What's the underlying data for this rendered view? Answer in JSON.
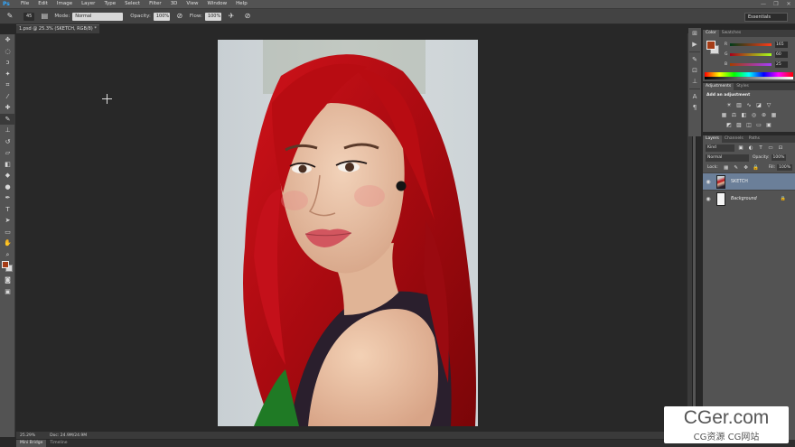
{
  "app": {
    "logo": "Ps"
  },
  "menu": [
    "File",
    "Edit",
    "Image",
    "Layer",
    "Type",
    "Select",
    "Filter",
    "3D",
    "View",
    "Window",
    "Help"
  ],
  "window_controls": {
    "minimize": "—",
    "restore": "❐",
    "close": "✕"
  },
  "options_bar": {
    "brush_size": "45",
    "mode_label": "Mode:",
    "mode_value": "Normal",
    "opacity_label": "Opacity:",
    "opacity_value": "100%",
    "flow_label": "Flow:",
    "flow_value": "100%",
    "workspace": "Essentials"
  },
  "document": {
    "tab_title": "1.psd @ 25.3% (SKETCH, RGB/8) *",
    "zoom": "25.29%",
    "doc_info": "Doc: 24.9M/24.9M"
  },
  "bottom_tabs": [
    "Mini Bridge",
    "Timeline"
  ],
  "tools": [
    "move-icon",
    "marquee-icon",
    "lasso-icon",
    "quick-select-icon",
    "crop-icon",
    "eyedropper-icon",
    "healing-icon",
    "brush-icon",
    "clone-stamp-icon",
    "history-brush-icon",
    "eraser-icon",
    "gradient-icon",
    "blur-icon",
    "dodge-icon",
    "pen-icon",
    "type-icon",
    "path-select-icon",
    "rectangle-icon",
    "hand-icon",
    "zoom-icon"
  ],
  "colors": {
    "foreground": "#a53c16",
    "background": "#dadada",
    "accent": "#6b7f99"
  },
  "color_panel": {
    "tabs": [
      "Color",
      "Swatches"
    ],
    "r_label": "R",
    "r_value": "165",
    "g_label": "G",
    "g_value": "60",
    "b_label": "B",
    "b_value": "25"
  },
  "adjustments_panel": {
    "tabs": [
      "Adjustments",
      "Styles"
    ],
    "title": "Add an adjustment"
  },
  "layers_panel": {
    "tabs": [
      "Layers",
      "Channels",
      "Paths"
    ],
    "kind": "Kind",
    "blend_mode": "Normal",
    "opacity_label": "Opacity:",
    "opacity_value": "100%",
    "lock_label": "Lock:",
    "fill_label": "Fill:",
    "fill_value": "100%",
    "layers": [
      {
        "name": "SKETCH",
        "selected": true
      },
      {
        "name": "Background",
        "locked": true
      }
    ]
  },
  "watermark": {
    "main": "CGer.com",
    "sub": "CG资源 CG网站"
  }
}
